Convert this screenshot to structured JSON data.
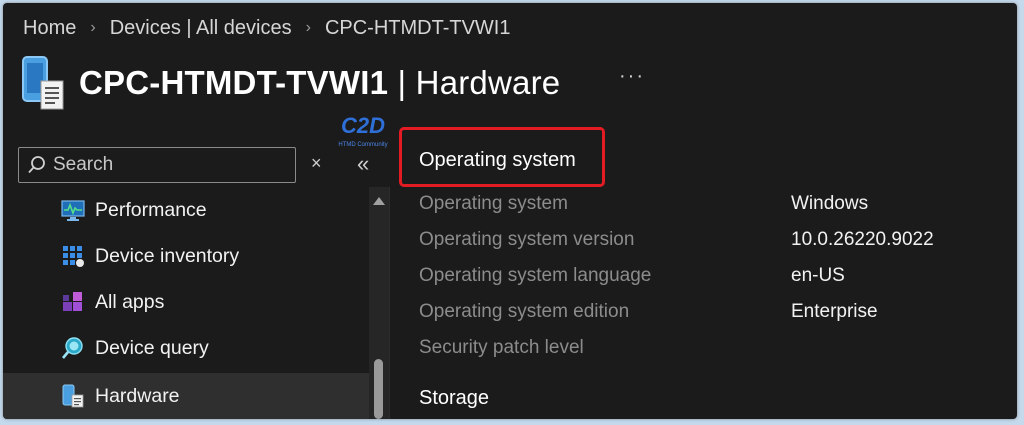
{
  "breadcrumb": {
    "home": "Home",
    "devices": "Devices | All devices",
    "current": "CPC-HTMDT-TVWI1"
  },
  "header": {
    "title_device": "CPC-HTMDT-TVWI1",
    "title_separator": " | ",
    "title_section": "Hardware",
    "more_label": "···",
    "icon": "device-icon"
  },
  "watermark": {
    "text": "HTMD Community",
    "logo_text": "C2D"
  },
  "search": {
    "placeholder": "Search",
    "value": "",
    "clear_label": "×",
    "collapse_label": "«"
  },
  "nav": {
    "items": [
      {
        "label": "Performance",
        "icon": "performance-icon",
        "active": false
      },
      {
        "label": "Device inventory",
        "icon": "device-inventory-icon",
        "active": false
      },
      {
        "label": "All apps",
        "icon": "all-apps-icon",
        "active": false
      },
      {
        "label": "Device query",
        "icon": "device-query-icon",
        "active": false
      },
      {
        "label": "Hardware",
        "icon": "hardware-icon",
        "active": true
      }
    ]
  },
  "main": {
    "section_title": "Operating system",
    "properties": [
      {
        "key": "Operating system",
        "value": "Windows"
      },
      {
        "key": "Operating system version",
        "value": "10.0.26220.9022"
      },
      {
        "key": "Operating system language",
        "value": "en-US"
      },
      {
        "key": "Operating system edition",
        "value": "Enterprise"
      },
      {
        "key": "Security patch level",
        "value": ""
      }
    ],
    "storage_title": "Storage"
  },
  "colors": {
    "background": "#1b1b1b",
    "highlight": "#e31b23",
    "muted_text": "#8c8c8c",
    "active_nav": "#2f2f2f"
  }
}
